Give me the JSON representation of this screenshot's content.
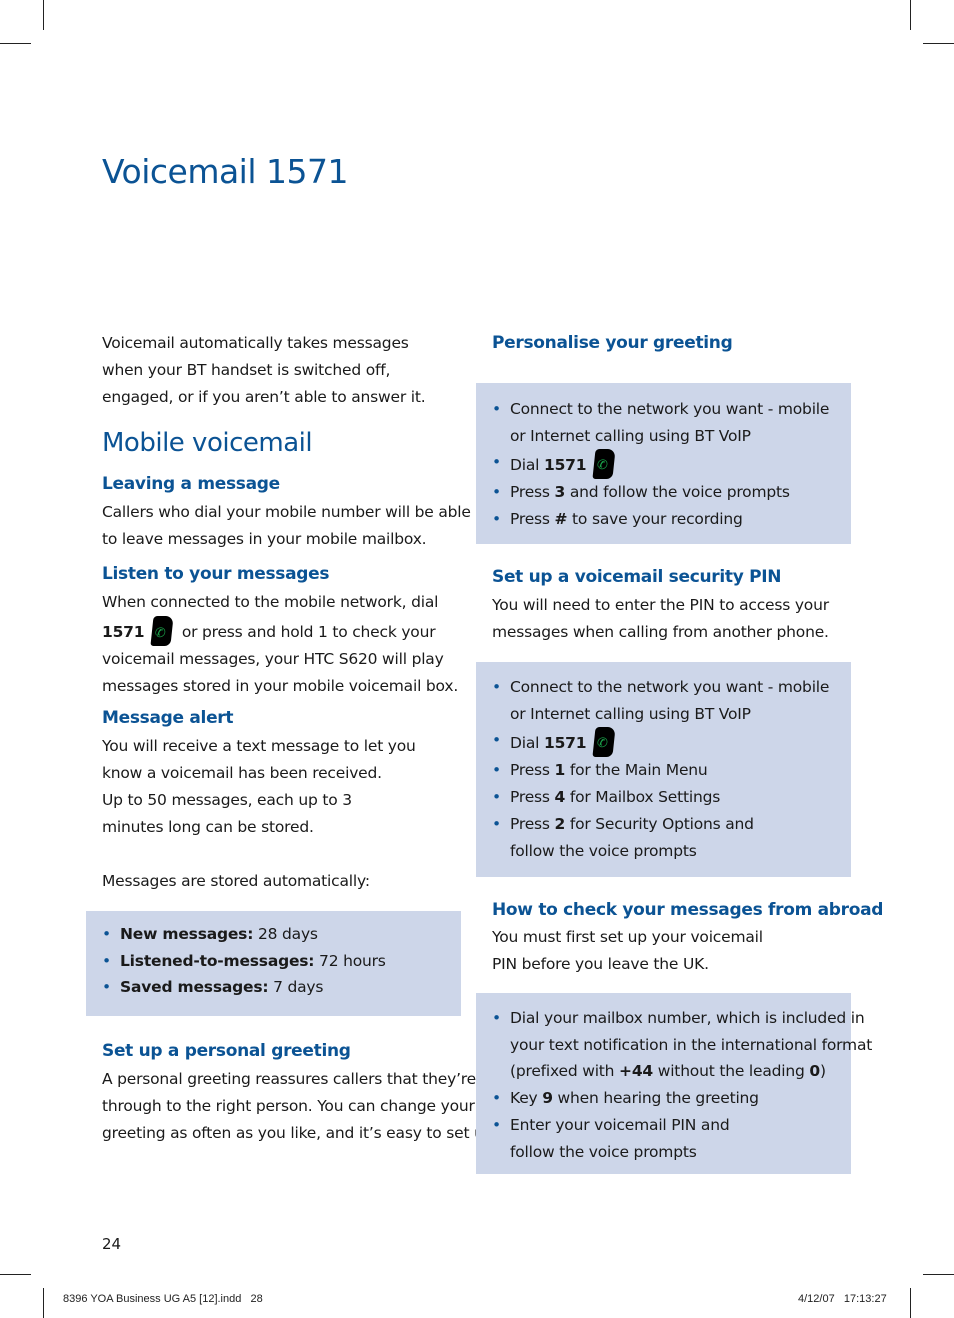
{
  "title": "Voicemail 1571",
  "intro": [
    "Voicemail automatically takes messages",
    "when your BT handset is switched off,",
    "engaged, or if you aren’t able to answer it."
  ],
  "mobile_voicemail": {
    "heading": "Mobile voicemail",
    "leaving": {
      "heading": "Leaving a message",
      "lines": [
        "Callers who dial your mobile number will be able",
        "to leave messages in your mobile mailbox."
      ]
    },
    "listen": {
      "heading": "Listen to your messages",
      "line1": "When connected to the mobile network, dial",
      "line2_bold": "1571",
      "line2_rest": "or press and hold 1 to check your",
      "line3": "voicemail messages, your HTC S620 will play",
      "line4": "messages stored in your mobile voicemail box."
    },
    "alert": {
      "heading": "Message alert",
      "lines": [
        "You will receive a text message to let you",
        "know a voicemail has been received.",
        "Up to 50 messages, each up to 3",
        "minutes long can be stored."
      ],
      "stored_intro": "Messages are stored automatically:"
    },
    "storage": [
      {
        "label": "New messages:",
        "value": " 28 days"
      },
      {
        "label": "Listened-to-messages:",
        "value": "72 hours"
      },
      {
        "label": "Saved messages:",
        "value": "7 days"
      }
    ],
    "greeting": {
      "heading": "Set up a personal greeting",
      "lines": [
        "A personal greeting reassures callers that they’re",
        "through to the right person. You can change your",
        "greeting as often as you like, and it’s easy to set up."
      ]
    }
  },
  "personalise": {
    "heading": "Personalise your greeting",
    "steps": [
      {
        "pre": "Connect to the network you want - mobile",
        "line2": "or Internet calling using BT VoIP"
      },
      {
        "pre": "Dial ",
        "bold": "1571",
        "phone": true
      },
      {
        "pre": "Press ",
        "bold": "3",
        "post": " and follow the voice prompts"
      },
      {
        "pre": "Press ",
        "bold": "#",
        "post": " to save your recording"
      }
    ]
  },
  "pin": {
    "heading": "Set up a voicemail security PIN",
    "lines": [
      "You will need to enter the PIN to access your",
      "messages when calling from another phone."
    ],
    "steps": [
      {
        "pre": "Connect to the network you want - mobile",
        "line2": "or Internet calling using BT VoIP"
      },
      {
        "pre": "Dial ",
        "bold": "1571",
        "phone": true
      },
      {
        "pre": "Press ",
        "bold": "1",
        "post": " for the Main Menu"
      },
      {
        "pre": "Press ",
        "bold": "4",
        "post": " for Mailbox Settings"
      },
      {
        "pre": "Press ",
        "bold": "2",
        "post": " for Security Options and",
        "line2": "follow the voice prompts"
      }
    ]
  },
  "abroad": {
    "heading": "How to check your messages from abroad",
    "lines": [
      "You must first set up your voicemail",
      "PIN before you leave the UK."
    ],
    "steps": [
      {
        "pre": "Dial your mailbox number, which is included in",
        "line2": "your text notification in the international format",
        "line3_pre": "(prefixed with ",
        "line3_bold1": "+44",
        "line3_mid": " without the leading ",
        "line3_bold2": "0",
        "line3_post": ")"
      },
      {
        "pre": "Key ",
        "bold": "9",
        "post": " when hearing the greeting"
      },
      {
        "pre": "Enter your voicemail PIN and",
        "line2": "follow the voice prompts"
      }
    ]
  },
  "page_number": "24",
  "footer": {
    "file": "8396 YOA Business UG A5 [12].indd   28",
    "timestamp": "4/12/07   17:13:27"
  },
  "colors": {
    "heading": "#0b5394",
    "box": "#cdd6e9"
  }
}
